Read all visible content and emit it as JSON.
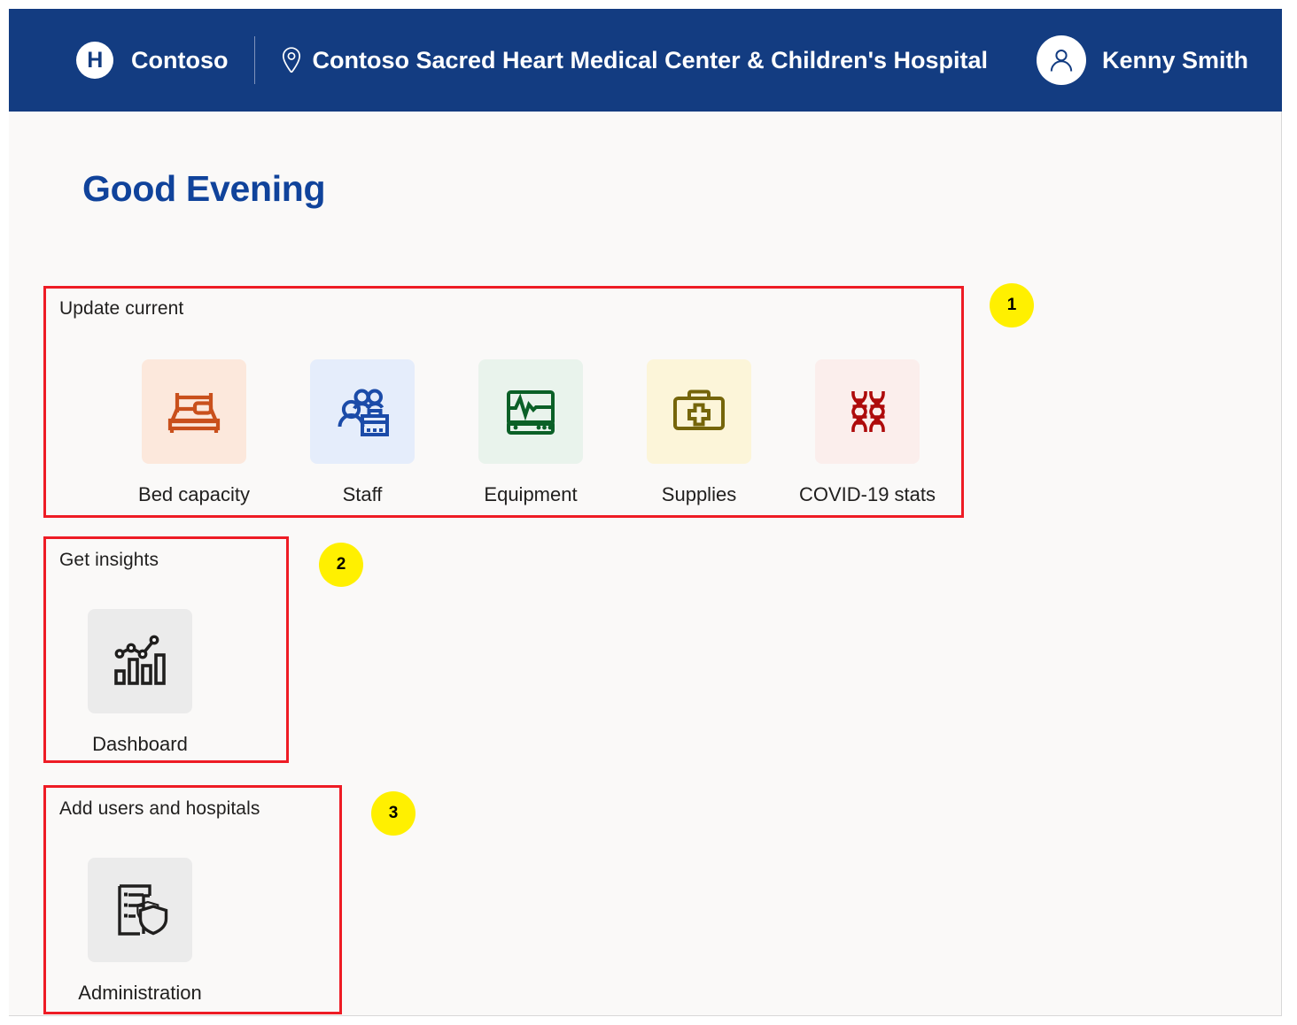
{
  "header": {
    "logo_icon": "hospital-h-logo-icon",
    "brand_name": "Contoso",
    "location_icon": "location-pin-icon",
    "site_name": "Contoso Sacred Heart Medical Center & Children's Hospital",
    "avatar_icon": "user-avatar-icon",
    "user_name": "Kenny Smith",
    "background_color": "#133c81"
  },
  "page": {
    "greeting": "Good Evening",
    "greeting_color": "#10439b",
    "background_color": "#faf9f8"
  },
  "sections": [
    {
      "title": "Update current",
      "tiles": [
        {
          "label": "Bed capacity",
          "icon": "bed-icon",
          "icon_color": "#c9501c",
          "tile_color": "#fce8dc"
        },
        {
          "label": "Staff",
          "icon": "people-briefcase-icon",
          "icon_color": "#1b4ba8",
          "tile_color": "#e5edfb"
        },
        {
          "label": "Equipment",
          "icon": "vitals-monitor-icon",
          "icon_color": "#0b6027",
          "tile_color": "#e9f3ec"
        },
        {
          "label": "Supplies",
          "icon": "first-aid-kit-icon",
          "icon_color": "#75650a",
          "tile_color": "#fcf5d9"
        },
        {
          "label": "COVID-19 stats",
          "icon": "dna-helix-icon",
          "icon_color": "#ae0b0b",
          "tile_color": "#fbeeec"
        }
      ]
    },
    {
      "title": "Get insights",
      "tiles": [
        {
          "label": "Dashboard",
          "icon": "bar-chart-trend-icon",
          "icon_color": "#201f1e",
          "tile_color": "#ebebeb"
        }
      ]
    },
    {
      "title": "Add users and hospitals",
      "tiles": [
        {
          "label": "Administration",
          "icon": "document-shield-icon",
          "icon_color": "#201f1e",
          "tile_color": "#ebebeb"
        }
      ]
    }
  ],
  "annotations": {
    "box_color": "#ee1c25",
    "badge_color": "#fff000",
    "badges": [
      "1",
      "2",
      "3"
    ]
  }
}
